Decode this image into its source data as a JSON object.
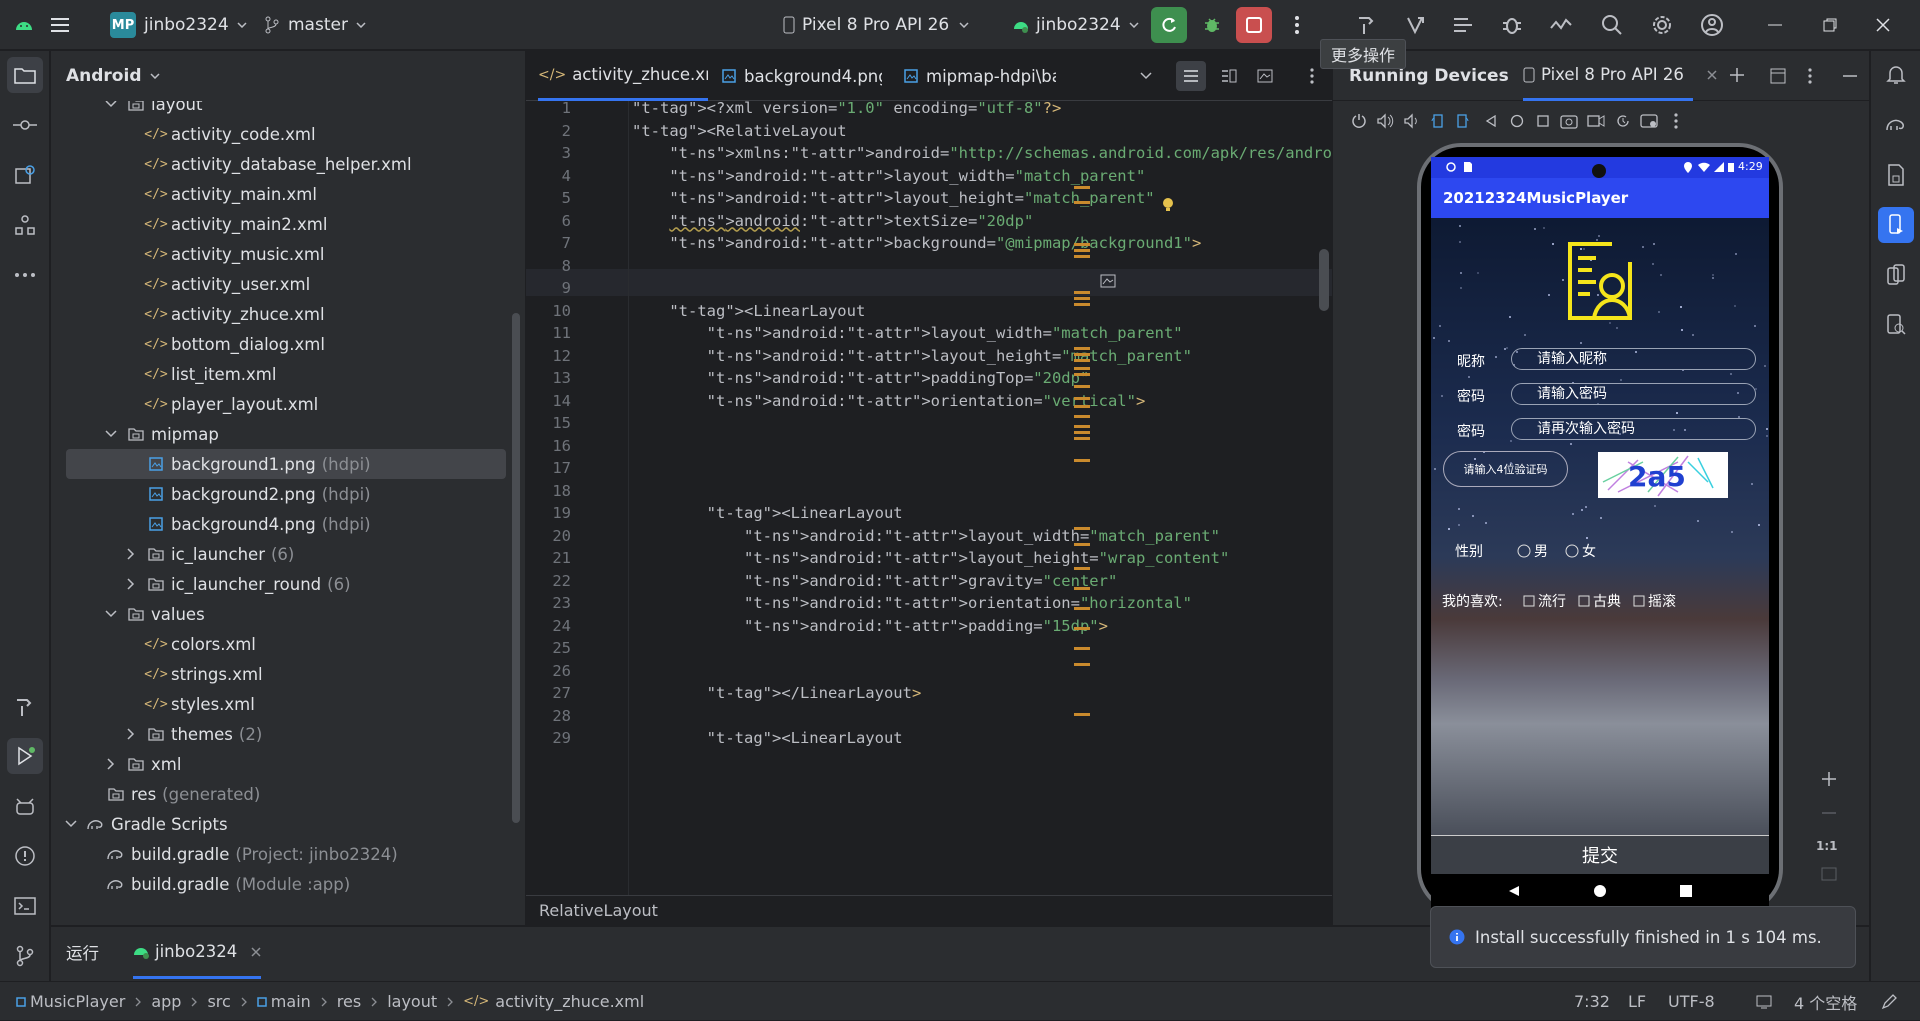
{
  "topbar": {
    "project_badge": "MP",
    "project_name": "jinbo2324",
    "branch": "master",
    "device": "Pixel 8 Pro API 26",
    "profile": "jinbo2324",
    "tooltip": "更多操作"
  },
  "project_panel": {
    "title": "Android",
    "items": [
      {
        "label": "layout",
        "hint": ""
      },
      {
        "label": "activity_code.xml",
        "hint": ""
      },
      {
        "label": "activity_database_helper.xml",
        "hint": ""
      },
      {
        "label": "activity_main.xml",
        "hint": ""
      },
      {
        "label": "activity_main2.xml",
        "hint": ""
      },
      {
        "label": "activity_music.xml",
        "hint": ""
      },
      {
        "label": "activity_user.xml",
        "hint": ""
      },
      {
        "label": "activity_zhuce.xml",
        "hint": ""
      },
      {
        "label": "bottom_dialog.xml",
        "hint": ""
      },
      {
        "label": "list_item.xml",
        "hint": ""
      },
      {
        "label": "player_layout.xml",
        "hint": ""
      },
      {
        "label": "mipmap",
        "hint": ""
      },
      {
        "label": "background1.png",
        "hint": "(hdpi)"
      },
      {
        "label": "background2.png",
        "hint": "(hdpi)"
      },
      {
        "label": "background4.png",
        "hint": "(hdpi)"
      },
      {
        "label": "ic_launcher",
        "hint": "(6)"
      },
      {
        "label": "ic_launcher_round",
        "hint": "(6)"
      },
      {
        "label": "values",
        "hint": ""
      },
      {
        "label": "colors.xml",
        "hint": ""
      },
      {
        "label": "strings.xml",
        "hint": ""
      },
      {
        "label": "styles.xml",
        "hint": ""
      },
      {
        "label": "themes",
        "hint": "(2)"
      },
      {
        "label": "xml",
        "hint": ""
      },
      {
        "label": "res",
        "hint": "(generated)"
      },
      {
        "label": "Gradle Scripts",
        "hint": ""
      },
      {
        "label": "build.gradle",
        "hint": "(Project: jinbo2324)"
      },
      {
        "label": "build.gradle",
        "hint": "(Module :app)"
      }
    ]
  },
  "editor": {
    "tabs": [
      "activity_zhuce.xml",
      "background4.png",
      "mipmap-hdpi\\bac"
    ],
    "breadcrumb": "RelativeLayout",
    "lines": [
      {
        "n": "1",
        "text": "<?xml version=\"1.0\" encoding=\"utf-8\"?>"
      },
      {
        "n": "2",
        "text": "<RelativeLayout"
      },
      {
        "n": "3",
        "text": "    xmlns:android=\"http://schemas.android.com/apk/res/android\""
      },
      {
        "n": "4",
        "text": "    android:layout_width=\"match_parent\""
      },
      {
        "n": "5",
        "text": "    android:layout_height=\"match_parent\""
      },
      {
        "n": "6",
        "text": "    android:textSize=\"20dp\""
      },
      {
        "n": "7",
        "text": "    android:background=\"@mipmap/background1\">"
      },
      {
        "n": "8",
        "text": ""
      },
      {
        "n": "9",
        "text": ""
      },
      {
        "n": "10",
        "text": "    <LinearLayout"
      },
      {
        "n": "11",
        "text": "        android:layout_width=\"match_parent\""
      },
      {
        "n": "12",
        "text": "        android:layout_height=\"match_parent\""
      },
      {
        "n": "13",
        "text": "        android:paddingTop=\"20dp\""
      },
      {
        "n": "14",
        "text": "        android:orientation=\"vertical\">"
      },
      {
        "n": "15",
        "text": ""
      },
      {
        "n": "16",
        "text": ""
      },
      {
        "n": "17",
        "text": ""
      },
      {
        "n": "18",
        "text": ""
      },
      {
        "n": "19",
        "text": "        <LinearLayout"
      },
      {
        "n": "20",
        "text": "            android:layout_width=\"match_parent\""
      },
      {
        "n": "21",
        "text": "            android:layout_height=\"wrap_content\""
      },
      {
        "n": "22",
        "text": "            android:gravity=\"center\""
      },
      {
        "n": "23",
        "text": "            android:orientation=\"horizontal\""
      },
      {
        "n": "24",
        "text": "            android:padding=\"15dp\">"
      },
      {
        "n": "25",
        "text": ""
      },
      {
        "n": "26",
        "text": ""
      },
      {
        "n": "27",
        "text": "        </LinearLayout>"
      },
      {
        "n": "28",
        "text": ""
      },
      {
        "n": "29",
        "text": "        <LinearLayout"
      }
    ]
  },
  "devices": {
    "tab_running": "Running Devices",
    "tab_device": "Pixel 8 Pro API 26",
    "status_time": "4:29",
    "app_title": "20212324MusicPlayer",
    "fields": [
      {
        "label": "昵称",
        "placeholder": "请输入昵称"
      },
      {
        "label": "密码",
        "placeholder": "请输入密码"
      },
      {
        "label": "密码",
        "placeholder": "请再次输入密码"
      }
    ],
    "captcha_hint": "请输入4位验证码",
    "captcha_text": "2a5",
    "gender_label": "性别",
    "gender_options": [
      "男",
      "女"
    ],
    "hobby_label": "我的喜欢:",
    "hobby_options": [
      "流行",
      "古典",
      "摇滚"
    ],
    "submit": "提交",
    "zoom_ratio": "1:1",
    "toast": "Install successfully finished in 1 s 104 ms."
  },
  "runbar": {
    "label": "运行",
    "config": "jinbo2324"
  },
  "statusbar": {
    "path": [
      "MusicPlayer",
      "app",
      "src",
      "main",
      "res",
      "layout",
      "activity_zhuce.xml"
    ],
    "position": "7:32",
    "line_sep": "LF",
    "encoding": "UTF-8",
    "indent": "4 个空格"
  },
  "colors": {
    "accent": "#3574f0",
    "run_green": "#3e8f4f",
    "stop_red": "#c94f4f",
    "app_bar": "#2d48f0"
  }
}
